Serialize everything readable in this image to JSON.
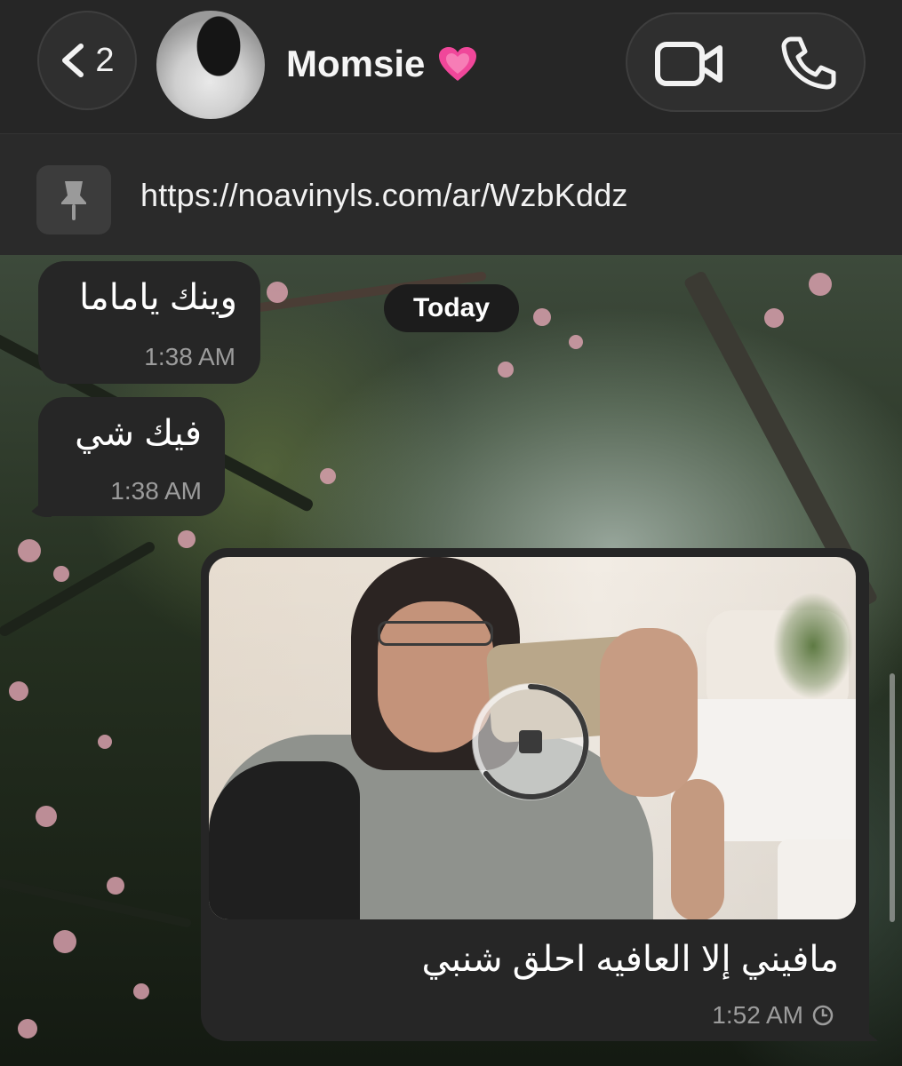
{
  "header": {
    "back_count": "2",
    "contact_name": "Momsie",
    "contact_emoji": "growing-heart-emoji"
  },
  "pinned": {
    "icon": "pin-icon",
    "link": "https://noavinyls.com/ar/WzbKddz"
  },
  "date_chip": "Today",
  "messages": [
    {
      "direction": "incoming",
      "text": "وينك ياماما",
      "time": "1:38 AM"
    },
    {
      "direction": "incoming",
      "text": "فيك شي",
      "time": "1:38 AM"
    },
    {
      "direction": "outgoing",
      "type": "video",
      "caption": "مافيني إلا العافيه احلق شنبي",
      "time": "1:52 AM",
      "status_icon": "clock-icon"
    }
  ],
  "colors": {
    "header_bg": "#262626",
    "bubble_bg": "#262626",
    "heart": "#f0479a"
  }
}
